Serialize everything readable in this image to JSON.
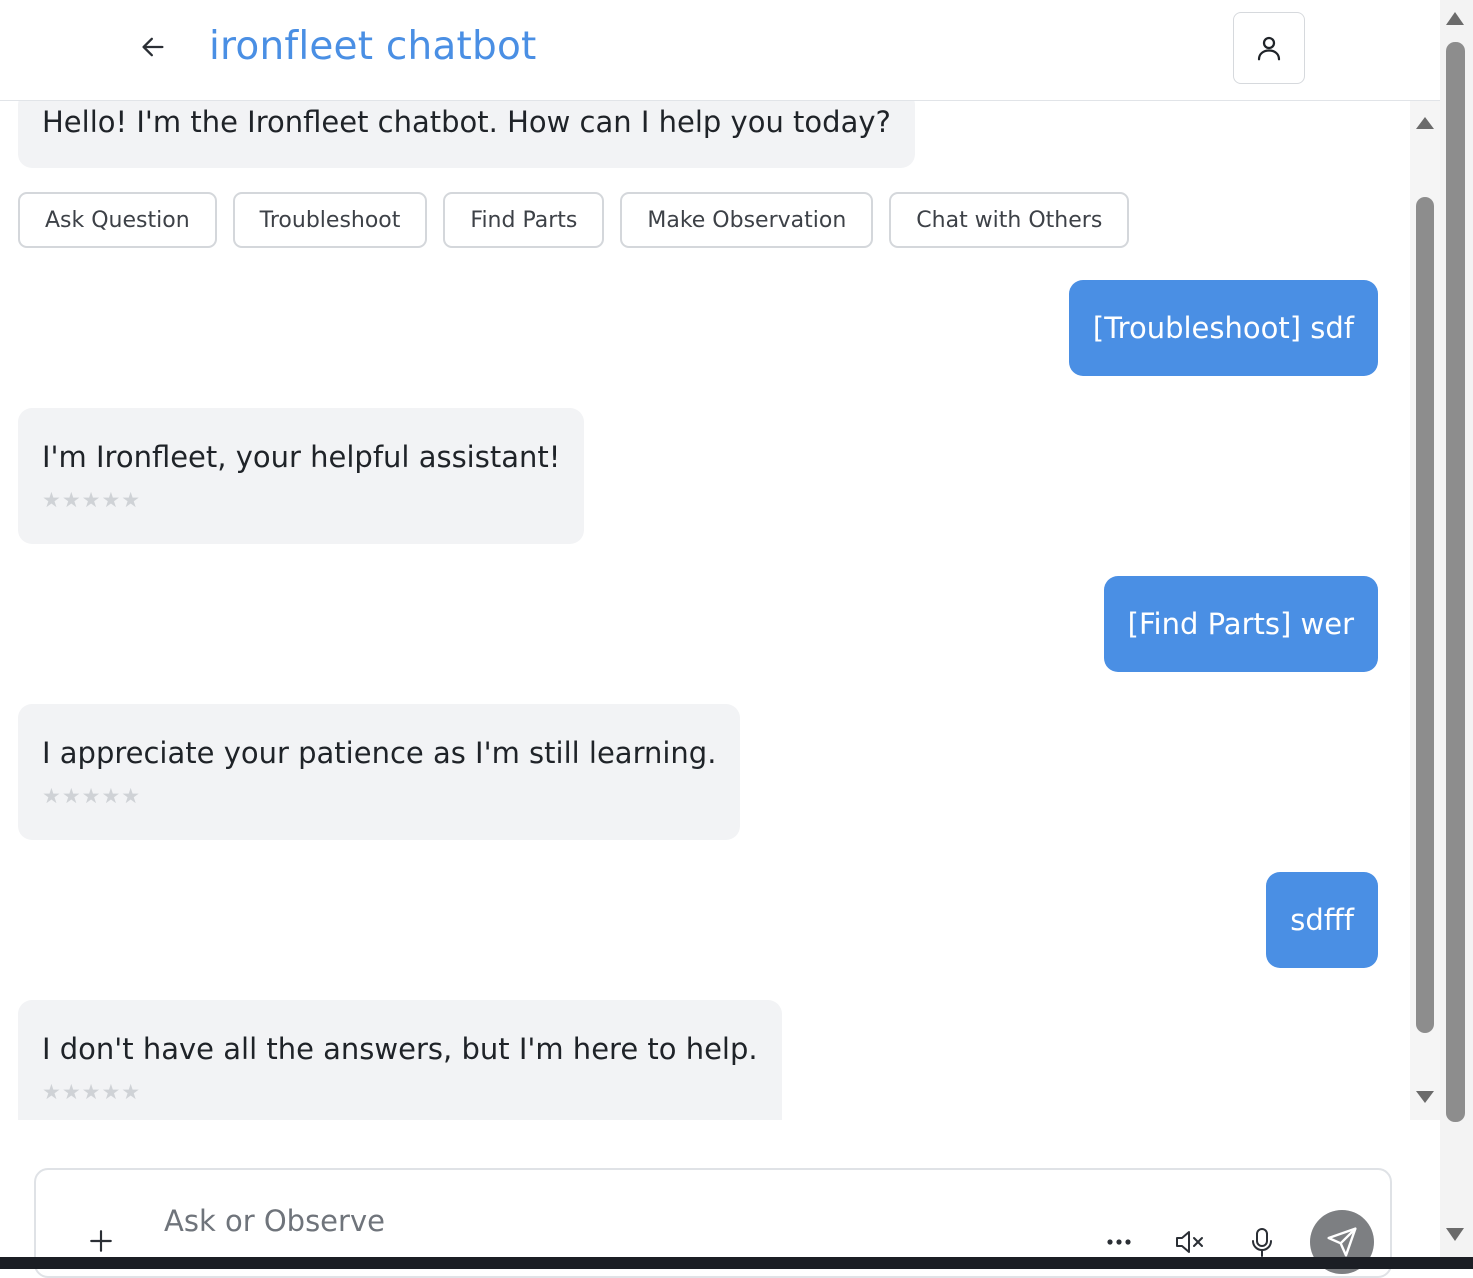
{
  "header": {
    "title": "ironfleet chatbot",
    "back_icon": "arrow-left-icon",
    "profile_icon": "user-icon"
  },
  "messages": [
    {
      "role": "bot",
      "text": "Hello! I'm the Ironfleet chatbot. How can I help you today?"
    },
    {
      "role": "user",
      "text": "[Troubleshoot] sdf"
    },
    {
      "role": "bot",
      "text": "I'm Ironfleet, your helpful assistant!",
      "rating": "★★★★★"
    },
    {
      "role": "user",
      "text": "[Find Parts] wer"
    },
    {
      "role": "bot",
      "text": "I appreciate your patience as I'm still learning.",
      "rating": "★★★★★"
    },
    {
      "role": "user",
      "text": "sdfff"
    },
    {
      "role": "bot",
      "text": "I don't have all the answers, but I'm here to help.",
      "rating": "★★★★★"
    }
  ],
  "quick_actions": [
    "Ask Question",
    "Troubleshoot",
    "Find Parts",
    "Make Observation",
    "Chat with Others"
  ],
  "composer": {
    "placeholder": "Ask or Observe",
    "value": "",
    "icons": [
      "plus-icon",
      "more-icon",
      "speaker-mute-icon",
      "microphone-icon",
      "send-icon"
    ]
  },
  "colors": {
    "accent": "#4a8fe4",
    "bot_bubble": "#f2f3f5",
    "send_button": "#7d7f82"
  }
}
